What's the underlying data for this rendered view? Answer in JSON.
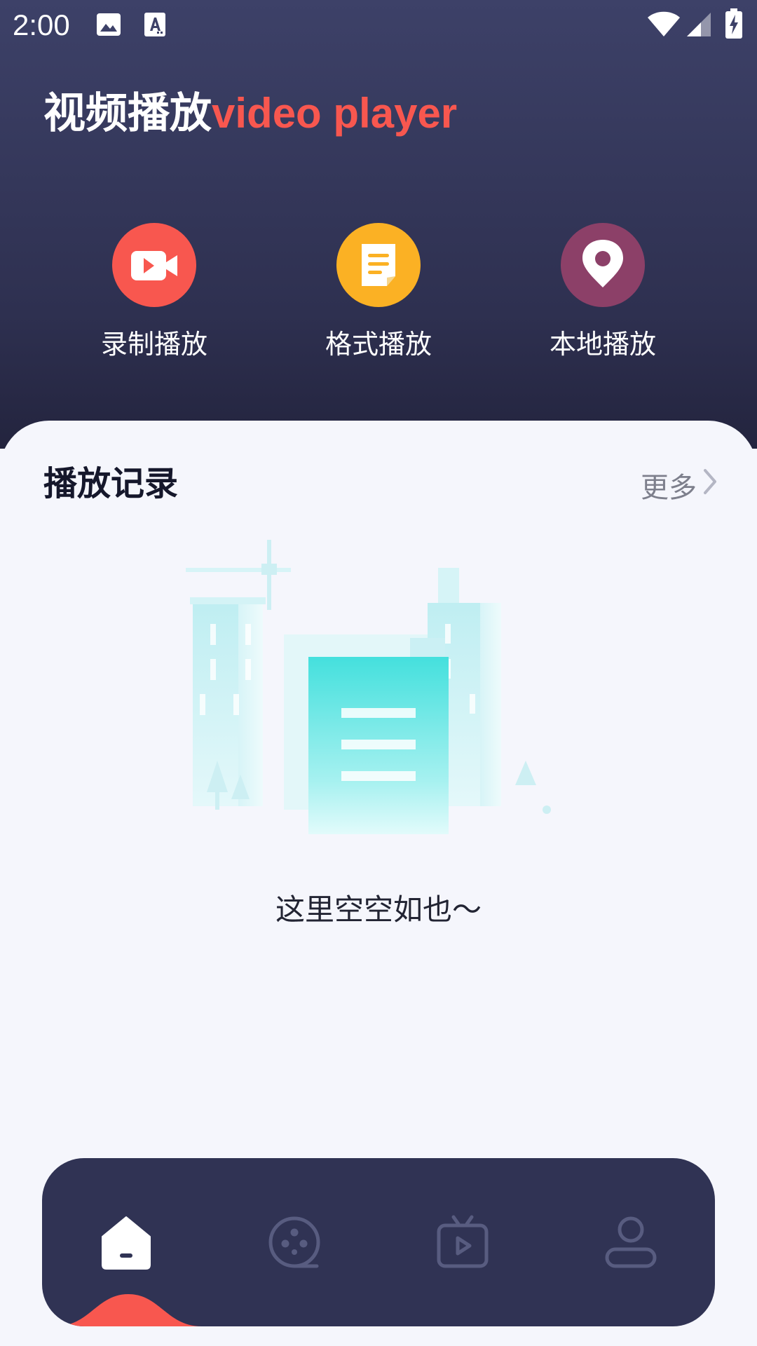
{
  "status_bar": {
    "time": "2:00",
    "icons": [
      "image-icon",
      "text-a-icon",
      "wifi-icon",
      "signal-icon",
      "battery-charging-icon"
    ]
  },
  "header": {
    "title_cn": "视频播放",
    "title_en": "video player"
  },
  "features": [
    {
      "label": "录制播放",
      "icon": "video-camera-icon",
      "color": "#f8574f"
    },
    {
      "label": "格式播放",
      "icon": "document-icon",
      "color": "#fbb124"
    },
    {
      "label": "本地播放",
      "icon": "location-pin-icon",
      "color": "#8c4068"
    }
  ],
  "history": {
    "title": "播放记录",
    "more_label": "更多",
    "empty_text": "这里空空如也～",
    "illustration": "empty-city-illustration"
  },
  "bottom_nav": {
    "items": [
      {
        "name": "home",
        "icon": "home-icon",
        "active": true
      },
      {
        "name": "film",
        "icon": "film-reel-icon",
        "active": false
      },
      {
        "name": "tv",
        "icon": "tv-play-icon",
        "active": false
      },
      {
        "name": "profile",
        "icon": "user-icon",
        "active": false
      }
    ],
    "active_indicator_color": "#f8574f"
  },
  "colors": {
    "hero_bg": "#3d4168",
    "accent": "#f8574f",
    "nav_bg": "#303354",
    "page_bg": "#f5f6fc"
  }
}
